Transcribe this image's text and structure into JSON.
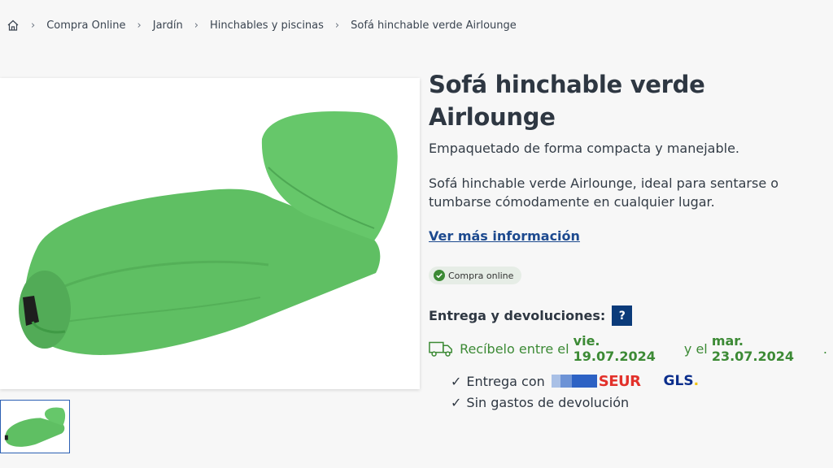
{
  "breadcrumb": {
    "items": [
      "Compra Online",
      "Jardín",
      "Hinchables y piscinas",
      "Sofá hinchable verde Airlounge"
    ]
  },
  "product": {
    "title": "Sofá hinchable verde Airlounge",
    "subtitle": "Empaquetado de forma compacta y manejable.",
    "description": "Sofá hinchable verde Airlounge, ideal para sentarse o tumbarse cómodamente en cualquier lugar.",
    "more_link": "Ver más información",
    "badge": "Compra online"
  },
  "delivery": {
    "heading": "Entrega y devoluciones:",
    "help_label": "?",
    "receive_prefix": "Recíbelo entre el ",
    "date_from": "vie. 19.07.2024",
    "receive_middle": " y el ",
    "date_to": "mar. 23.07.2024",
    "receive_suffix": ".",
    "check_1": "Entrega con",
    "carrier_1": "SEUR",
    "carrier_2": "GLS",
    "carrier_2_dot": ".",
    "check_2": "Sin gastos de devolución"
  },
  "colors": {
    "accent": "#0b3b7a",
    "link": "#1d4a8f",
    "success": "#3c8a35",
    "product": "#5fbf63"
  },
  "icons": [
    "home-icon",
    "check-circle-icon",
    "truck-icon",
    "help-icon"
  ]
}
